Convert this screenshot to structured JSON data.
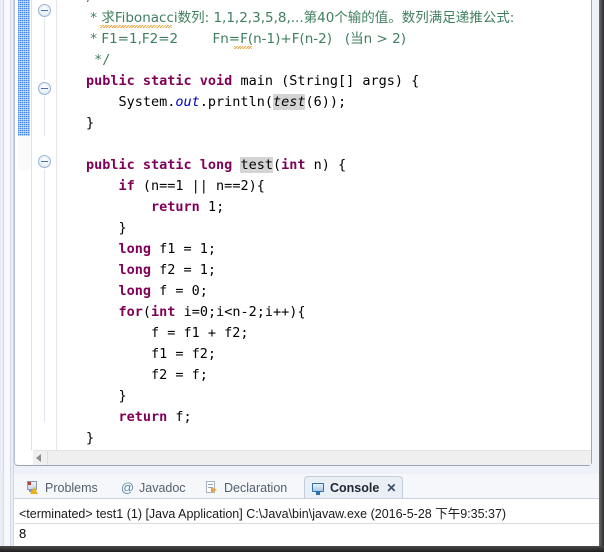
{
  "editor": {
    "name": "java-source-editor",
    "lines": [
      {
        "indent": 0,
        "segments": [
          {
            "t": "/*",
            "c": "cmt"
          }
        ]
      },
      {
        "indent": 0,
        "segments": [
          {
            "t": " * 求Fibonacci数列: 1,1,2,3,5,8,...第40个输的值。数列满足递推公式:",
            "c": "cmt"
          }
        ]
      },
      {
        "indent": 0,
        "segments": [
          {
            "t": " * F1=1,F2=2        Fn=F(n-1)+F(n-2)   (当n > 2)",
            "c": "cmt"
          }
        ]
      },
      {
        "indent": 0,
        "segments": [
          {
            "t": " */",
            "c": "cmt"
          }
        ]
      },
      {
        "indent": 0,
        "segments": [
          {
            "t": "public static void ",
            "c": "kw"
          },
          {
            "t": "main (String[] args) {",
            "c": "plain"
          }
        ]
      },
      {
        "indent": 0,
        "segments": [
          {
            "t": "    System.",
            "c": "plain"
          },
          {
            "t": "out",
            "c": "fld"
          },
          {
            "t": ".println(",
            "c": "plain"
          },
          {
            "t": "test",
            "c": "occi"
          },
          {
            "t": "(6));",
            "c": "plain"
          }
        ]
      },
      {
        "indent": 0,
        "segments": [
          {
            "t": "}",
            "c": "plain"
          }
        ]
      },
      {
        "indent": 0,
        "segments": [
          {
            "t": "",
            "c": "plain"
          }
        ]
      },
      {
        "indent": 0,
        "segments": [
          {
            "t": "public static long ",
            "c": "kw"
          },
          {
            "t": "test",
            "c": "occ"
          },
          {
            "t": "(",
            "c": "plain"
          },
          {
            "t": "int",
            "c": "kw"
          },
          {
            "t": " n) {",
            "c": "plain"
          }
        ]
      },
      {
        "indent": 0,
        "segments": [
          {
            "t": "    ",
            "c": "plain"
          },
          {
            "t": "if",
            "c": "kw"
          },
          {
            "t": " (n==1 || n==2){",
            "c": "plain"
          }
        ]
      },
      {
        "indent": 0,
        "segments": [
          {
            "t": "        ",
            "c": "plain"
          },
          {
            "t": "return",
            "c": "kw"
          },
          {
            "t": " 1;",
            "c": "plain"
          }
        ]
      },
      {
        "indent": 0,
        "segments": [
          {
            "t": "    }",
            "c": "plain"
          }
        ]
      },
      {
        "indent": 0,
        "segments": [
          {
            "t": "    ",
            "c": "plain"
          },
          {
            "t": "long",
            "c": "kw"
          },
          {
            "t": " f1 = 1;",
            "c": "plain"
          }
        ]
      },
      {
        "indent": 0,
        "segments": [
          {
            "t": "    ",
            "c": "plain"
          },
          {
            "t": "long",
            "c": "kw"
          },
          {
            "t": " f2 = 1;",
            "c": "plain"
          }
        ]
      },
      {
        "indent": 0,
        "segments": [
          {
            "t": "    ",
            "c": "plain"
          },
          {
            "t": "long",
            "c": "kw"
          },
          {
            "t": " f = 0;",
            "c": "plain"
          }
        ]
      },
      {
        "indent": 0,
        "segments": [
          {
            "t": "    ",
            "c": "plain"
          },
          {
            "t": "for",
            "c": "kw"
          },
          {
            "t": "(",
            "c": "plain"
          },
          {
            "t": "int",
            "c": "kw"
          },
          {
            "t": " i=0;i<n-2;i++){",
            "c": "plain"
          }
        ]
      },
      {
        "indent": 0,
        "segments": [
          {
            "t": "        f = f1 + f2;",
            "c": "plain"
          }
        ]
      },
      {
        "indent": 0,
        "segments": [
          {
            "t": "        f1 = f2;",
            "c": "plain"
          }
        ]
      },
      {
        "indent": 0,
        "segments": [
          {
            "t": "        f2 = f;",
            "c": "plain"
          }
        ]
      },
      {
        "indent": 0,
        "segments": [
          {
            "t": "    }",
            "c": "plain"
          }
        ]
      },
      {
        "indent": 0,
        "segments": [
          {
            "t": "    ",
            "c": "plain"
          },
          {
            "t": "return",
            "c": "kw"
          },
          {
            "t": " f;",
            "c": "plain"
          }
        ]
      },
      {
        "indent": 0,
        "segments": [
          {
            "t": "}",
            "c": "plain"
          }
        ]
      }
    ],
    "closing_brace": "}",
    "colors": {
      "keyword": "#7F0055",
      "comment": "#3F7F5F",
      "field": "#0000C0",
      "occurrence_highlight": "#D4D4D4",
      "current_line_highlight": "#E8F0FC",
      "change_bar": "#8CBDF2"
    }
  },
  "bottom_panel": {
    "tabs": [
      {
        "id": "tab-problems",
        "label": "Problems",
        "icon": "problems-icon",
        "active": false
      },
      {
        "id": "tab-javadoc",
        "label": "Javadoc",
        "icon": "at-sign-icon",
        "active": false
      },
      {
        "id": "tab-declaration",
        "label": "Declaration",
        "icon": "declaration-icon",
        "active": false
      },
      {
        "id": "tab-console",
        "label": "Console",
        "icon": "console-icon",
        "active": true
      }
    ],
    "close_glyph": "✕",
    "console": {
      "launch_line": "<terminated> test1 (1) [Java Application] C:\\Java\\bin\\javaw.exe (2016-5-28 下午9:35:37)",
      "output": "8"
    }
  }
}
